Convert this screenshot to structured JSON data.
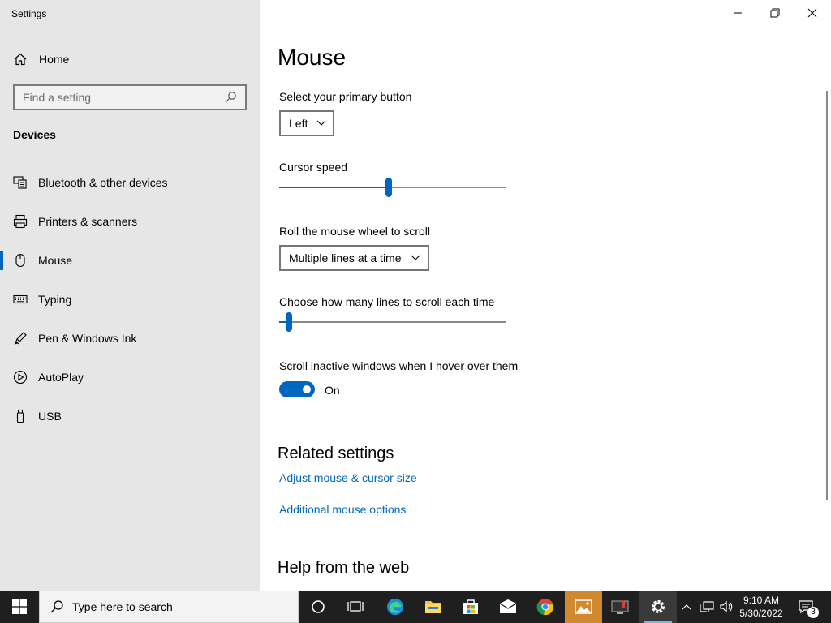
{
  "window": {
    "title": "Settings"
  },
  "sidebar": {
    "home_label": "Home",
    "search_placeholder": "Find a setting",
    "section_heading": "Devices",
    "items": [
      {
        "label": "Bluetooth & other devices",
        "icon": "bluetooth-devices-icon"
      },
      {
        "label": "Printers & scanners",
        "icon": "printer-icon"
      },
      {
        "label": "Mouse",
        "icon": "mouse-icon",
        "active": true
      },
      {
        "label": "Typing",
        "icon": "keyboard-icon"
      },
      {
        "label": "Pen & Windows Ink",
        "icon": "pen-icon"
      },
      {
        "label": "AutoPlay",
        "icon": "autoplay-icon"
      },
      {
        "label": "USB",
        "icon": "usb-icon"
      }
    ]
  },
  "main": {
    "title": "Mouse",
    "primary_button": {
      "label": "Select your primary button",
      "value": "Left"
    },
    "cursor_speed": {
      "label": "Cursor speed",
      "level": 0.48
    },
    "wheel_scroll": {
      "label": "Roll the mouse wheel to scroll",
      "value": "Multiple lines at a time"
    },
    "lines_to_scroll": {
      "label": "Choose how many lines to scroll each time",
      "level": 0.03
    },
    "inactive_scroll": {
      "label": "Scroll inactive windows when I hover over them",
      "state": "On"
    },
    "related": {
      "title": "Related settings",
      "links": [
        "Adjust mouse & cursor size",
        "Additional mouse options"
      ]
    },
    "help_title": "Help from the web"
  },
  "taskbar": {
    "search_placeholder": "Type here to search",
    "time": "9:10 AM",
    "date": "5/30/2022",
    "notification_count": "3"
  },
  "colors": {
    "accent": "#0067c0",
    "sidebar_bg": "#e6e6e6",
    "taskbar_bg": "#1f1f1f"
  }
}
